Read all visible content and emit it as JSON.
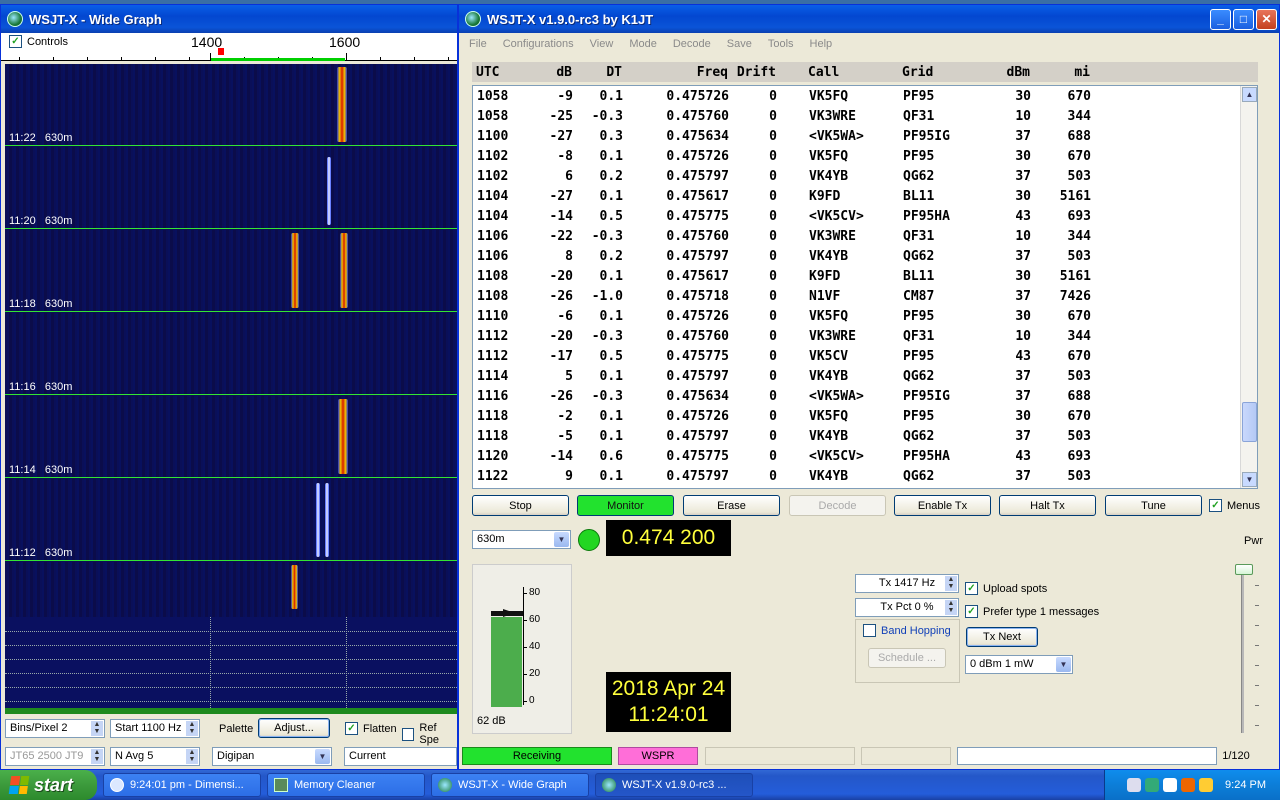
{
  "wide_graph": {
    "title": "WSJT-X - Wide Graph",
    "controls_label": "Controls",
    "scale_labels": [
      "1400",
      "1600"
    ],
    "rows": [
      {
        "time": "11:22",
        "band": "630m"
      },
      {
        "time": "11:20",
        "band": "630m"
      },
      {
        "time": "11:18",
        "band": "630m"
      },
      {
        "time": "11:16",
        "band": "630m"
      },
      {
        "time": "11:14",
        "band": "630m"
      },
      {
        "time": "11:12",
        "band": "630m"
      }
    ],
    "bins_pixel": "Bins/Pixel  2",
    "start": "Start 1100 Hz",
    "palette_label": "Palette",
    "adjust_label": "Adjust...",
    "flatten_label": "Flatten",
    "ref_spec_label": "Ref Spe",
    "mode_spin": "JT65  2500  JT9",
    "navg": "N Avg 5",
    "palette_value": "Digipan",
    "spec_value": "Current"
  },
  "main": {
    "title": "WSJT-X   v1.9.0-rc3   by K1JT",
    "menu": [
      "File",
      "Configurations",
      "View",
      "Mode",
      "Decode",
      "Save",
      "Tools",
      "Help"
    ],
    "columns": [
      "UTC",
      "dB",
      "DT",
      "Freq",
      "Drift",
      "Call",
      "Grid",
      "dBm",
      "mi"
    ],
    "decodes": [
      [
        "1058",
        "-9",
        "0.1",
        "0.475726",
        "0",
        "VK5FQ",
        "PF95",
        "30",
        "670"
      ],
      [
        "1058",
        "-25",
        "-0.3",
        "0.475760",
        "0",
        "VK3WRE",
        "QF31",
        "10",
        "344"
      ],
      [
        "1100",
        "-27",
        "0.3",
        "0.475634",
        "0",
        "<VK5WA>",
        "PF95IG",
        "37",
        "688"
      ],
      [
        "1102",
        "-8",
        "0.1",
        "0.475726",
        "0",
        "VK5FQ",
        "PF95",
        "30",
        "670"
      ],
      [
        "1102",
        "6",
        "0.2",
        "0.475797",
        "0",
        "VK4YB",
        "QG62",
        "37",
        "503"
      ],
      [
        "1104",
        "-27",
        "0.1",
        "0.475617",
        "0",
        "K9FD",
        "BL11",
        "30",
        "5161"
      ],
      [
        "1104",
        "-14",
        "0.5",
        "0.475775",
        "0",
        "<VK5CV>",
        "PF95HA",
        "43",
        "693"
      ],
      [
        "1106",
        "-22",
        "-0.3",
        "0.475760",
        "0",
        "VK3WRE",
        "QF31",
        "10",
        "344"
      ],
      [
        "1106",
        "8",
        "0.2",
        "0.475797",
        "0",
        "VK4YB",
        "QG62",
        "37",
        "503"
      ],
      [
        "1108",
        "-20",
        "0.1",
        "0.475617",
        "0",
        "K9FD",
        "BL11",
        "30",
        "5161"
      ],
      [
        "1108",
        "-26",
        "-1.0",
        "0.475718",
        "0",
        "N1VF",
        "CM87",
        "37",
        "7426"
      ],
      [
        "1110",
        "-6",
        "0.1",
        "0.475726",
        "0",
        "VK5FQ",
        "PF95",
        "30",
        "670"
      ],
      [
        "1112",
        "-20",
        "-0.3",
        "0.475760",
        "0",
        "VK3WRE",
        "QF31",
        "10",
        "344"
      ],
      [
        "1112",
        "-17",
        "0.5",
        "0.475775",
        "0",
        "VK5CV",
        "PF95",
        "43",
        "670"
      ],
      [
        "1114",
        "5",
        "0.1",
        "0.475797",
        "0",
        "VK4YB",
        "QG62",
        "37",
        "503"
      ],
      [
        "1116",
        "-26",
        "-0.3",
        "0.475634",
        "0",
        "<VK5WA>",
        "PF95IG",
        "37",
        "688"
      ],
      [
        "1118",
        "-2",
        "0.1",
        "0.475726",
        "0",
        "VK5FQ",
        "PF95",
        "30",
        "670"
      ],
      [
        "1118",
        "-5",
        "0.1",
        "0.475797",
        "0",
        "VK4YB",
        "QG62",
        "37",
        "503"
      ],
      [
        "1120",
        "-14",
        "0.6",
        "0.475775",
        "0",
        "<VK5CV>",
        "PF95HA",
        "43",
        "693"
      ],
      [
        "1122",
        "9",
        "0.1",
        "0.475797",
        "0",
        "VK4YB",
        "QG62",
        "37",
        "503"
      ]
    ],
    "buttons": {
      "stop": "Stop",
      "monitor": "Monitor",
      "erase": "Erase",
      "decode": "Decode",
      "enable_tx": "Enable Tx",
      "halt_tx": "Halt Tx",
      "tune": "Tune",
      "menus": "Menus"
    },
    "band": "630m",
    "dial_freq": "0.474 200",
    "meter_ticks": [
      "80",
      "60",
      "40",
      "20",
      "0"
    ],
    "meter_level_db": "62 dB",
    "clock_date": "2018 Apr 24",
    "clock_time": "11:24:01",
    "tx_freq": "Tx  1417  Hz",
    "tx_pct": "Tx Pct 0  %",
    "band_hopping": "Band Hopping",
    "schedule": "Schedule ...",
    "upload_spots": "Upload spots",
    "prefer_type1": "Prefer type 1 messages",
    "tx_next": "Tx Next",
    "power_select": "0 dBm  1 mW",
    "pwr_label": "Pwr",
    "status_receiving": "Receiving",
    "status_mode": "WSPR",
    "status_progress": "1/120",
    "colors": {
      "monitor": "#22e22e",
      "receiving": "#22e22e",
      "wspr": "#ff6ed8",
      "display_text": "#ffff3c"
    }
  },
  "taskbar": {
    "start": "start",
    "items": [
      "9:24:01 pm - Dimensi...",
      "Memory Cleaner",
      "WSJT-X - Wide Graph",
      "WSJT-X   v1.9.0-rc3   ..."
    ],
    "clock": "9:24 PM"
  }
}
